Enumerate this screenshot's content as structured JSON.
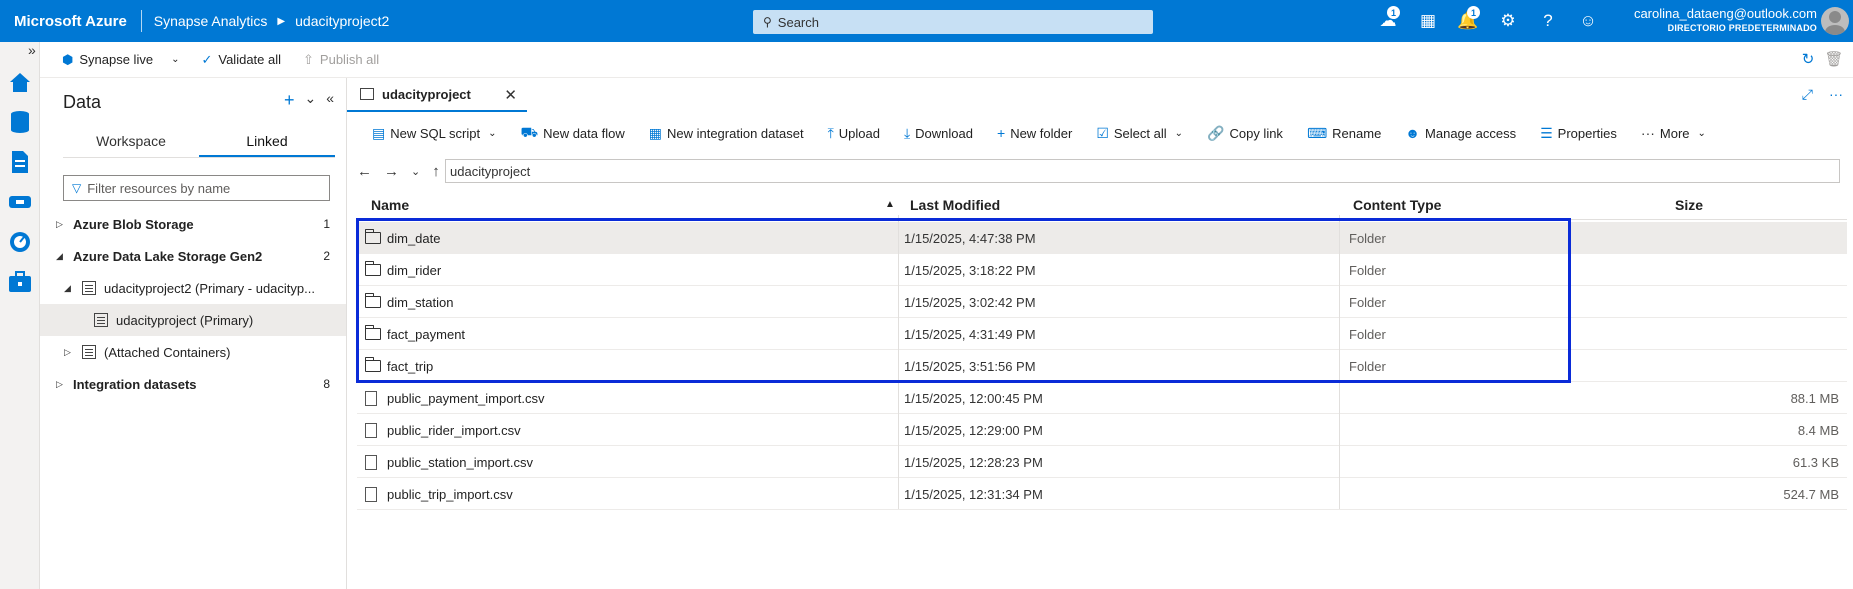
{
  "topbar": {
    "brand": "Microsoft Azure",
    "product": "Synapse Analytics",
    "workspace": "udacityproject2",
    "search_placeholder": "Search",
    "notif_badge_1": "1",
    "notif_badge_2": "1",
    "user_email": "carolina_dataeng@outlook.com",
    "user_directory": "DIRECTORIO PREDETERMINADO",
    "icons": [
      "feedback-icon",
      "portal-icon",
      "bell-icon",
      "settings-icon",
      "help-icon",
      "people-icon"
    ]
  },
  "commandbar": {
    "synapse_live": "Synapse live",
    "validate_all": "Validate all",
    "publish_all": "Publish all"
  },
  "panel": {
    "title": "Data",
    "tabs": [
      {
        "label": "Workspace"
      },
      {
        "label": "Linked"
      }
    ],
    "active_tab": "Linked",
    "filter_placeholder": "Filter resources by name",
    "tree": [
      {
        "label": "Azure Blob Storage",
        "count": "1"
      },
      {
        "label": "Azure Data Lake Storage Gen2",
        "count": "2"
      },
      {
        "label": "udacityproject2 (Primary - udacityp..."
      },
      {
        "label": "udacityproject (Primary)"
      },
      {
        "label": "(Attached Containers)"
      },
      {
        "label": "Integration datasets",
        "count": "8"
      }
    ]
  },
  "content": {
    "tab_label": "udacityproject",
    "toolbar": {
      "new_sql_script": "New SQL script",
      "new_data_flow": "New data flow",
      "new_integration_dataset": "New integration dataset",
      "upload": "Upload",
      "download": "Download",
      "new_folder": "New folder",
      "select_all": "Select all",
      "copy_link": "Copy link",
      "rename": "Rename",
      "manage_access": "Manage access",
      "properties": "Properties",
      "more": "More"
    },
    "path": "udacityproject",
    "columns": {
      "name": "Name",
      "last_modified": "Last Modified",
      "content_type": "Content Type",
      "size": "Size"
    },
    "rows": [
      {
        "name": "dim_date",
        "modified": "1/15/2025, 4:47:38 PM",
        "type": "Folder",
        "size": "",
        "kind": "folder"
      },
      {
        "name": "dim_rider",
        "modified": "1/15/2025, 3:18:22 PM",
        "type": "Folder",
        "size": "",
        "kind": "folder"
      },
      {
        "name": "dim_station",
        "modified": "1/15/2025, 3:02:42 PM",
        "type": "Folder",
        "size": "",
        "kind": "folder"
      },
      {
        "name": "fact_payment",
        "modified": "1/15/2025, 4:31:49 PM",
        "type": "Folder",
        "size": "",
        "kind": "folder"
      },
      {
        "name": "fact_trip",
        "modified": "1/15/2025, 3:51:56 PM",
        "type": "Folder",
        "size": "",
        "kind": "folder"
      },
      {
        "name": "public_payment_import.csv",
        "modified": "1/15/2025, 12:00:45 PM",
        "type": "",
        "size": "88.1 MB",
        "kind": "file"
      },
      {
        "name": "public_rider_import.csv",
        "modified": "1/15/2025, 12:29:00 PM",
        "type": "",
        "size": "8.4 MB",
        "kind": "file"
      },
      {
        "name": "public_station_import.csv",
        "modified": "1/15/2025, 12:28:23 PM",
        "type": "",
        "size": "61.3 KB",
        "kind": "file"
      },
      {
        "name": "public_trip_import.csv",
        "modified": "1/15/2025, 12:31:34 PM",
        "type": "",
        "size": "524.7 MB",
        "kind": "file"
      }
    ]
  }
}
